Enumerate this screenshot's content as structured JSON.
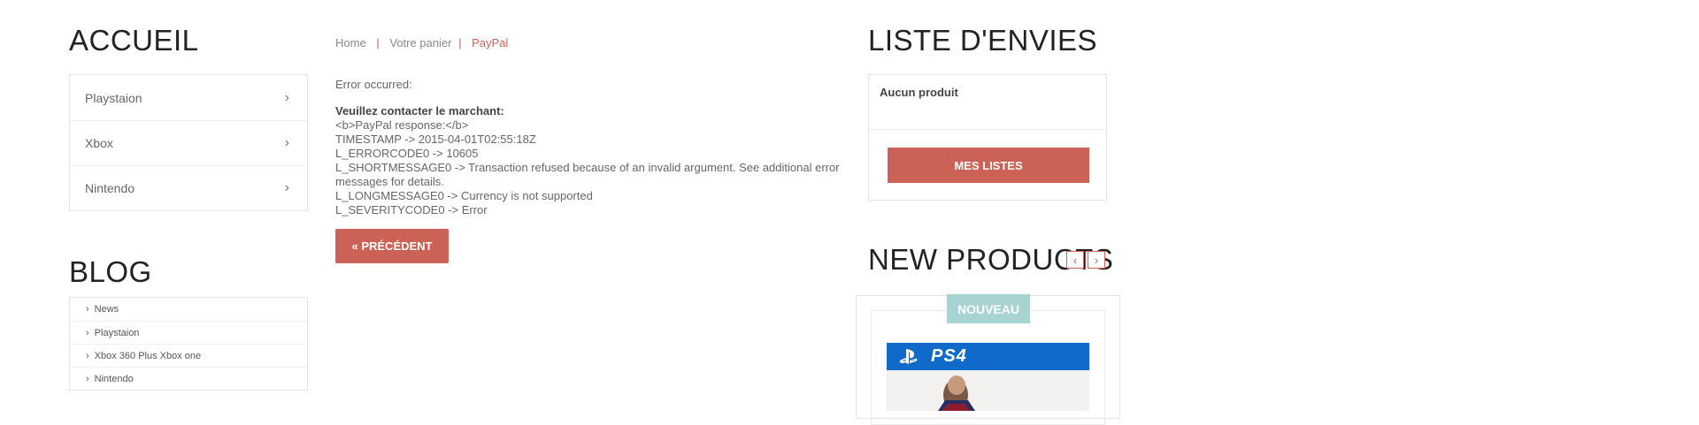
{
  "left": {
    "home_title": "ACCUEIL",
    "categories": [
      {
        "label": "Playstaion"
      },
      {
        "label": "Xbox"
      },
      {
        "label": "Nintendo"
      }
    ],
    "blog_title": "BLOG",
    "blog_items": [
      {
        "label": "News"
      },
      {
        "label": "Playstaion"
      },
      {
        "label": "Xbox 360 Plus Xbox one"
      },
      {
        "label": "Nintendo"
      }
    ]
  },
  "breadcrumb": {
    "home": "Home",
    "sep1": "|",
    "cart": "Votre panier",
    "sep2": "|",
    "current": "PayPal"
  },
  "error": {
    "occurred": "Error occurred:",
    "contact": "Veuillez contacter le marchant:",
    "lines": [
      "<b>PayPal response:</b>",
      "TIMESTAMP -> 2015-04-01T02:55:18Z",
      "L_ERRORCODE0 -> 10605",
      "L_SHORTMESSAGE0 -> Transaction refused because of an invalid argument. See additional error messages for details.",
      "L_LONGMESSAGE0 -> Currency is not supported",
      "L_SEVERITYCODE0 -> Error"
    ],
    "back_button": "« PRÉCÉDENT"
  },
  "wishlist": {
    "title": "LISTE D'ENVIES",
    "empty": "Aucun produit",
    "button": "MES LISTES"
  },
  "new_products": {
    "title": "NEW PRODUCTS",
    "prev_arrow": "‹",
    "next_arrow": "›",
    "badge": "NOUVEAU",
    "platform_label": "PS4"
  },
  "colors": {
    "accent": "#cc6155",
    "badge": "#a7d3d3",
    "ps4_blue": "#0f6ac9"
  }
}
